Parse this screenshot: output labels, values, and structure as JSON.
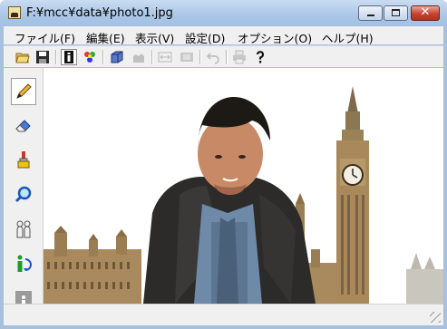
{
  "window": {
    "title": "F:¥mcc¥data¥photo1.jpg"
  },
  "menu": {
    "items": [
      "ファイル(F)",
      "編集(E)",
      "表示(V)",
      "設定(D)",
      "オプション(O)",
      "ヘルプ(H)"
    ]
  },
  "toolbar": {
    "buttons": [
      {
        "icon": "open-folder-icon",
        "state": "normal"
      },
      {
        "icon": "save-icon",
        "state": "normal"
      },
      {
        "icon": "info-icon",
        "state": "pressed"
      },
      {
        "icon": "color-palette-icon",
        "state": "normal"
      },
      {
        "icon": "3d-box-icon",
        "state": "normal"
      },
      {
        "icon": "building-icon",
        "state": "disabled"
      },
      {
        "icon": "resize-horizontal-icon",
        "state": "disabled"
      },
      {
        "icon": "film-icon",
        "state": "disabled"
      },
      {
        "icon": "undo-icon",
        "state": "disabled"
      },
      {
        "icon": "print-icon",
        "state": "disabled"
      },
      {
        "icon": "help-icon",
        "state": "normal"
      }
    ]
  },
  "palette": {
    "tools": [
      {
        "icon": "pencil-icon",
        "state": "pressed"
      },
      {
        "icon": "eraser-icon",
        "state": "normal"
      },
      {
        "icon": "paintbrush-icon",
        "state": "normal"
      },
      {
        "icon": "magnifier-icon",
        "state": "normal"
      },
      {
        "icon": "people-outline-icon",
        "state": "normal"
      },
      {
        "icon": "person-rotate-icon",
        "state": "normal"
      },
      {
        "icon": "person-silhouette-icon",
        "state": "disabled"
      }
    ]
  },
  "canvas": {
    "image": "photo-composite-man-with-big-ben"
  },
  "colors": {
    "titlebar": "#a9c5e6",
    "close_button": "#c84431",
    "chrome": "#f0f0f0",
    "clock_tower": "#a9895c"
  }
}
